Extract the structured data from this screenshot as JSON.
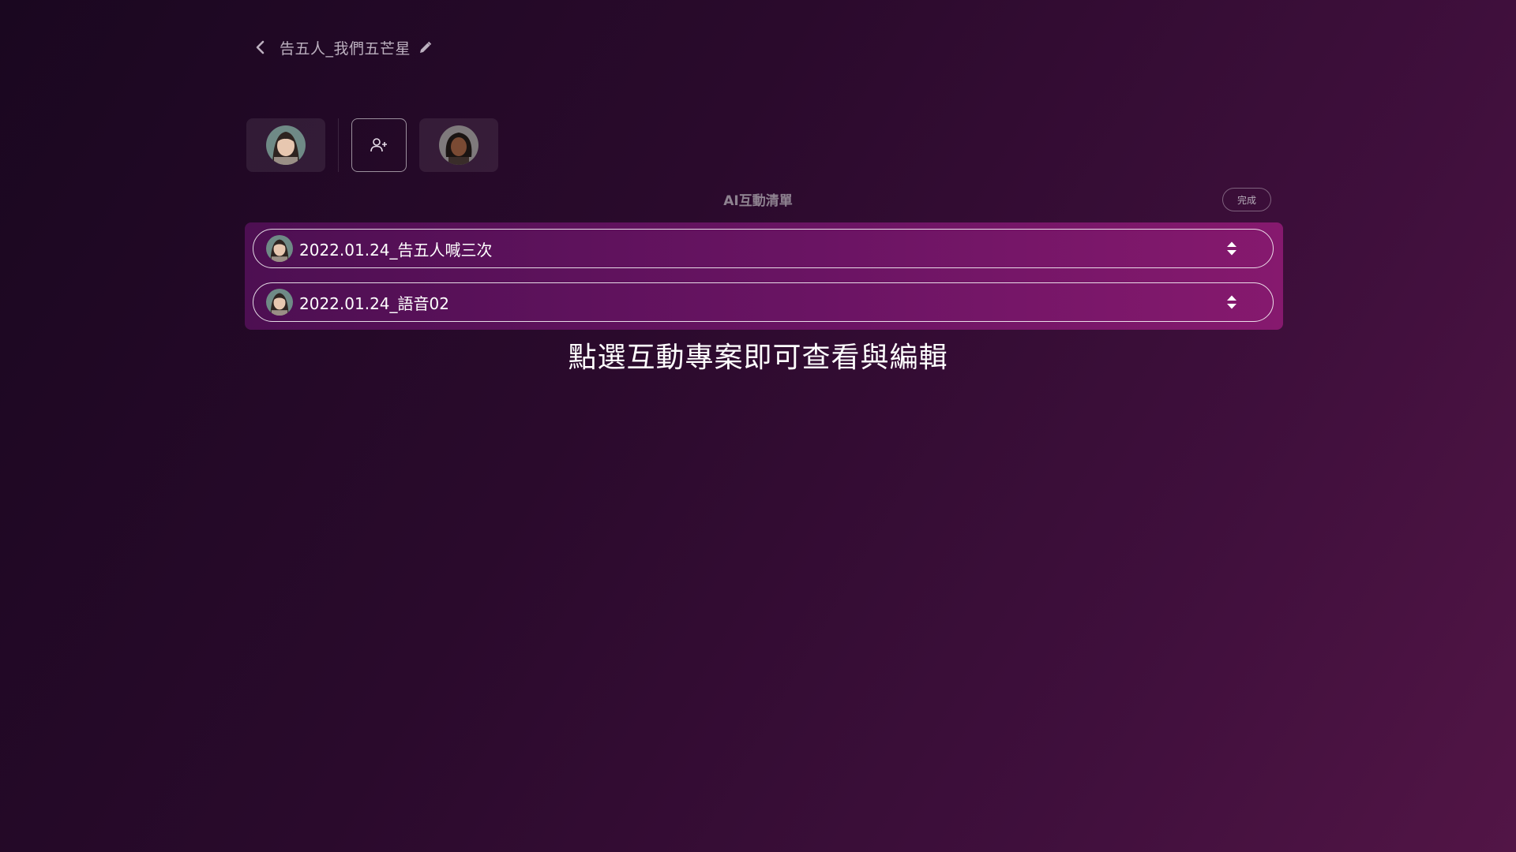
{
  "header": {
    "back_icon": "chevron-left-icon",
    "title": "告五人_我們五芒星",
    "edit_icon": "pencil-icon"
  },
  "characters": {
    "items": [
      {
        "name": "character-1",
        "avatar": "avatar-woman-1",
        "selected": true
      },
      {
        "name": "character-2",
        "avatar": "avatar-woman-2",
        "selected": false
      }
    ],
    "add_icon": "user-plus-icon"
  },
  "list": {
    "title": "AI互動清單",
    "done_label": "完成",
    "items": [
      {
        "label": "2022.01.24_告五人喊三次",
        "handle_icon": "sort-icon"
      },
      {
        "label": "2022.01.24_語音02",
        "handle_icon": "sort-icon"
      }
    ]
  },
  "hint": "點選互動專案即可查看與編輯",
  "colors": {
    "background_start": "#1a0720",
    "background_end": "#521546",
    "panel_start": "#4d0f52",
    "panel_end": "#86196e",
    "muted_text": "#8e8290"
  }
}
